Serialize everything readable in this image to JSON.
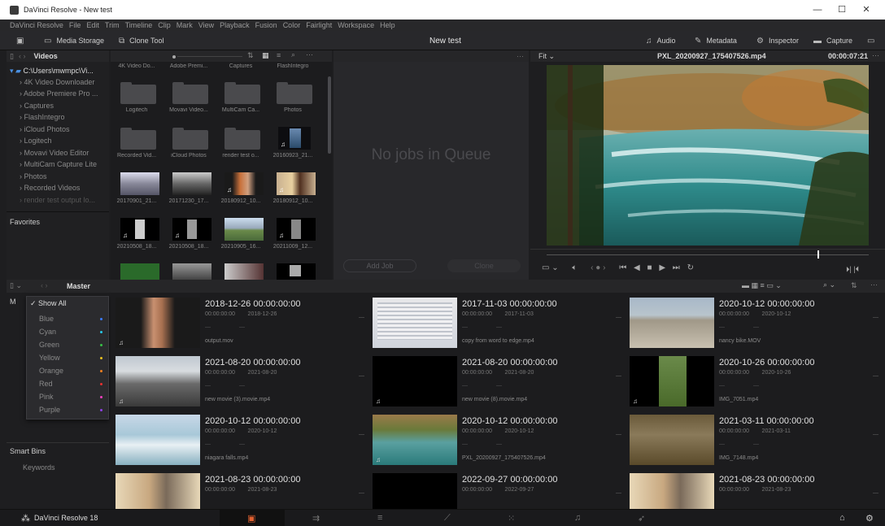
{
  "window": {
    "title": "DaVinci Resolve - New test"
  },
  "menu": [
    "DaVinci Resolve",
    "File",
    "Edit",
    "Trim",
    "Timeline",
    "Clip",
    "Mark",
    "View",
    "Playback",
    "Fusion",
    "Color",
    "Fairlight",
    "Workspace",
    "Help"
  ],
  "toolbar": {
    "media_storage": "Media Storage",
    "clone_tool": "Clone Tool",
    "project_title": "New test",
    "audio": "Audio",
    "metadata": "Metadata",
    "inspector": "Inspector",
    "capture": "Capture"
  },
  "storage": {
    "header": "Videos",
    "root": "C:\\Users\\mwmpc\\Vi...",
    "tree": [
      "4K Video Downloader",
      "Adobe Premiere Pro ...",
      "Captures",
      "FlashIntegro",
      "iCloud Photos",
      "Logitech",
      "Movavi Video Editor",
      "MultiCam Capture Lite",
      "Photos",
      "Recorded Videos",
      "render test output lo..."
    ],
    "favorites": "Favorites"
  },
  "media_grid": {
    "top_labels": [
      "4K Video Do...",
      "Adobe Premi...",
      "Captures",
      "FlashIntegro"
    ],
    "row1": [
      "Logitech",
      "Movavi Video...",
      "MultiCam Ca...",
      "Photos"
    ],
    "row2": [
      "Recorded Vid...",
      "iCloud Photos",
      "render test o...",
      "20160923_21..."
    ],
    "row3": [
      "20170901_21...",
      "20171230_17...",
      "20180912_10...",
      "20180912_10..."
    ],
    "row4": [
      "20210508_18...",
      "20210508_18...",
      "20210905_16...",
      "20211009_12..."
    ]
  },
  "clone": {
    "empty": "No jobs in Queue",
    "add_job": "Add Job",
    "clone_btn": "Clone"
  },
  "viewer": {
    "zoom": "Fit",
    "filename": "PXL_20200927_175407526.mp4",
    "timecode": "00:00:07:21",
    "progress": 0.84
  },
  "media_pool": {
    "bin": "Master",
    "smart_bins": "Smart Bins",
    "keywords": "Keywords"
  },
  "filter_menu": {
    "items": [
      {
        "label": "Show All",
        "color": ""
      },
      {
        "label": "Blue",
        "color": "#3b7bff"
      },
      {
        "label": "Cyan",
        "color": "#28c8e8"
      },
      {
        "label": "Green",
        "color": "#38c048"
      },
      {
        "label": "Yellow",
        "color": "#e8c020"
      },
      {
        "label": "Orange",
        "color": "#f08020"
      },
      {
        "label": "Red",
        "color": "#e83030"
      },
      {
        "label": "Pink",
        "color": "#f040c0"
      },
      {
        "label": "Purple",
        "color": "#9040e8"
      }
    ]
  },
  "clips": [
    {
      "date": "2018-12-26  00:00:00:00",
      "tc": "00:00:00:00",
      "d": "2018-12-26",
      "name": "output.mov"
    },
    {
      "date": "2017-11-03  00:00:00:00",
      "tc": "00:00:00:00",
      "d": "2017-11-03",
      "name": "copy from word to edge.mp4"
    },
    {
      "date": "2020-10-12  00:00:00:00",
      "tc": "00:00:00:00",
      "d": "2020-10-12",
      "name": "nancy bike.MOV"
    },
    {
      "date": "2021-08-20  00:00:00:00",
      "tc": "00:00:00:00",
      "d": "2021-08-20",
      "name": "new movie (3).movie.mp4"
    },
    {
      "date": "2021-08-20  00:00:00:00",
      "tc": "00:00:00:00",
      "d": "2021-08-20",
      "name": "new movie (8).movie.mp4"
    },
    {
      "date": "2020-10-26  00:00:00:00",
      "tc": "00:00:00:00",
      "d": "2020-10-26",
      "name": "IMG_7051.mp4"
    },
    {
      "date": "2020-10-12  00:00:00:00",
      "tc": "00:00:00:00",
      "d": "2020-10-12",
      "name": "niagara falls.mp4"
    },
    {
      "date": "2020-10-12  00:00:00:00",
      "tc": "00:00:00:00",
      "d": "2020-10-12",
      "name": "PXL_20200927_175407526.mp4"
    },
    {
      "date": "2021-03-11  00:00:00:00",
      "tc": "00:00:00:00",
      "d": "2021-03-11",
      "name": "IMG_7148.mp4"
    },
    {
      "date": "2021-08-23  00:00:00:00",
      "tc": "00:00:00:00",
      "d": "2021-08-23",
      "name": ""
    },
    {
      "date": "2022-09-27  00:00:00:00",
      "tc": "00:00:00:00",
      "d": "2022-09-27",
      "name": ""
    },
    {
      "date": "2021-08-23  00:00:00:00",
      "tc": "00:00:00:00",
      "d": "2021-08-23",
      "name": ""
    }
  ],
  "app_name": "DaVinci Resolve 18"
}
